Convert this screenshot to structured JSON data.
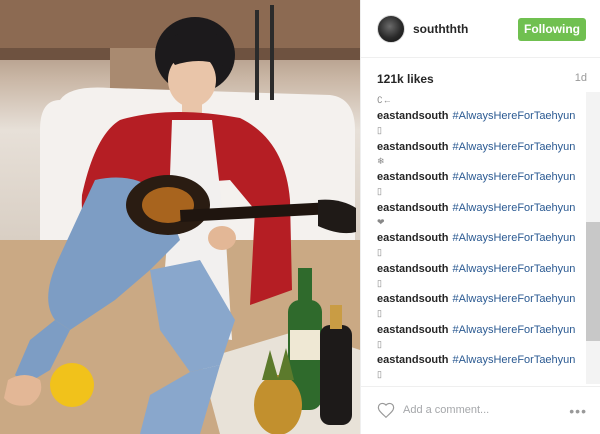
{
  "post": {
    "username": "souththth",
    "follow_label": "Following",
    "likes": "121k likes",
    "time": "1d"
  },
  "comments": [
    {
      "user": "",
      "tag": "",
      "sym": "∁←"
    },
    {
      "user": "eastandsouth",
      "tag": "#AlwaysHereForTaehyun",
      "sym": "▯"
    },
    {
      "user": "eastandsouth",
      "tag": "#AlwaysHereForTaehyun",
      "sym": "❄"
    },
    {
      "user": "eastandsouth",
      "tag": "#AlwaysHereForTaehyun",
      "sym": "▯"
    },
    {
      "user": "eastandsouth",
      "tag": "#AlwaysHereForTaehyun",
      "sym": "❤"
    },
    {
      "user": "eastandsouth",
      "tag": "#AlwaysHereForTaehyun",
      "sym": "▯"
    },
    {
      "user": "eastandsouth",
      "tag": "#AlwaysHereForTaehyun",
      "sym": "▯"
    },
    {
      "user": "eastandsouth",
      "tag": "#AlwaysHereForTaehyun",
      "sym": "▯"
    },
    {
      "user": "eastandsouth",
      "tag": "#AlwaysHereForTaehyun",
      "sym": "▯"
    },
    {
      "user": "eastandsouth",
      "tag": "#AlwaysHereForTaehyun",
      "sym": "▯"
    }
  ],
  "footer": {
    "comment_placeholder": "Add a comment...",
    "more_label": "•••"
  },
  "icons": {
    "like": "heart-icon",
    "options": "more-options-icon"
  },
  "colors": {
    "follow_button": "#70c050",
    "hashtag": "#2b5a92",
    "jacket": "#b51e24"
  }
}
